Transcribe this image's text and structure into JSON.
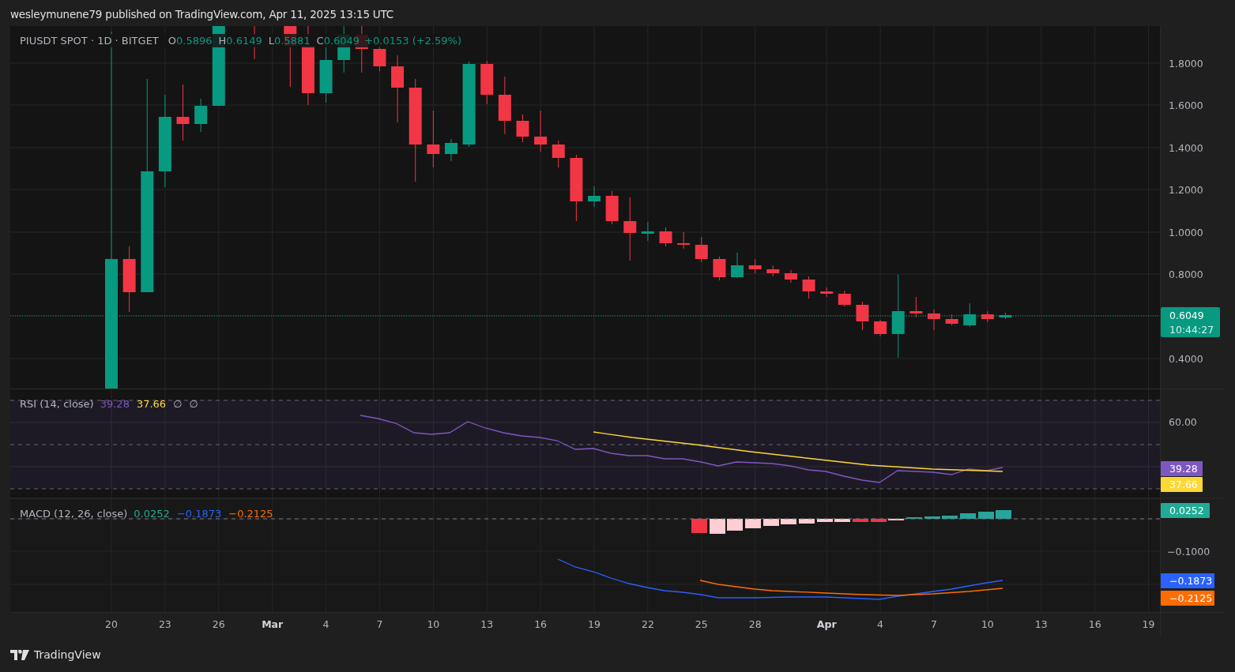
{
  "attribution": "wesleymunene79 published on TradingView.com, Apr 11, 2025 13:15 UTC",
  "price_pane": {
    "legend": {
      "symbol": "PIUSDT SPOT · 1D · BITGET",
      "ohlc": [
        {
          "key": "O",
          "value": "0.5896"
        },
        {
          "key": "H",
          "value": "0.6149"
        },
        {
          "key": "L",
          "value": "0.5881"
        },
        {
          "key": "C",
          "value": "0.6049"
        }
      ],
      "change": "+0.0153 (+2.59%)"
    },
    "axis": [
      "1.8000",
      "1.6000",
      "1.4000",
      "1.2000",
      "1.0000",
      "0.8000",
      "0.4000"
    ],
    "last_price": {
      "value": "0.6049",
      "countdown": "10:44:27",
      "color": "#089981"
    }
  },
  "rsi_pane": {
    "legend": {
      "title": "RSI (14, close)",
      "values": [
        {
          "text": "39.28",
          "color": "#7e57c2"
        },
        {
          "text": "37.66",
          "color": "#fdd835"
        },
        {
          "text": "∅"
        },
        {
          "text": "∅"
        }
      ]
    },
    "axis": [
      "60.00"
    ],
    "labels": [
      {
        "text": "39.28",
        "color": "#7e57c2"
      },
      {
        "text": "37.66",
        "color": "#fdd835"
      }
    ]
  },
  "macd_pane": {
    "legend": {
      "title": "MACD (12, 26, close)",
      "values": [
        {
          "text": "0.0252",
          "color": "#22ab94"
        },
        {
          "text": "−0.1873",
          "color": "#2962ff"
        },
        {
          "text": "−0.2125",
          "color": "#ff6d00"
        }
      ]
    },
    "axis": [
      "−0.1000"
    ],
    "labels": [
      {
        "text": "0.0252",
        "color": "#22ab94"
      },
      {
        "text": "−0.1873",
        "color": "#2962ff"
      },
      {
        "text": "−0.2125",
        "color": "#ff6d00"
      }
    ]
  },
  "time_axis": [
    {
      "label": "20",
      "kind": "day"
    },
    {
      "label": "23",
      "kind": "day"
    },
    {
      "label": "26",
      "kind": "day"
    },
    {
      "label": "Mar",
      "kind": "month"
    },
    {
      "label": "4",
      "kind": "day"
    },
    {
      "label": "7",
      "kind": "day"
    },
    {
      "label": "10",
      "kind": "day"
    },
    {
      "label": "13",
      "kind": "day"
    },
    {
      "label": "16",
      "kind": "day"
    },
    {
      "label": "19",
      "kind": "day"
    },
    {
      "label": "22",
      "kind": "day"
    },
    {
      "label": "25",
      "kind": "day"
    },
    {
      "label": "28",
      "kind": "day"
    },
    {
      "label": "Apr",
      "kind": "month"
    },
    {
      "label": "4",
      "kind": "day"
    },
    {
      "label": "7",
      "kind": "day"
    },
    {
      "label": "10",
      "kind": "day"
    },
    {
      "label": "13",
      "kind": "day"
    },
    {
      "label": "16",
      "kind": "day"
    },
    {
      "label": "19",
      "kind": "day"
    }
  ],
  "footer": {
    "brand": "TradingView"
  }
}
